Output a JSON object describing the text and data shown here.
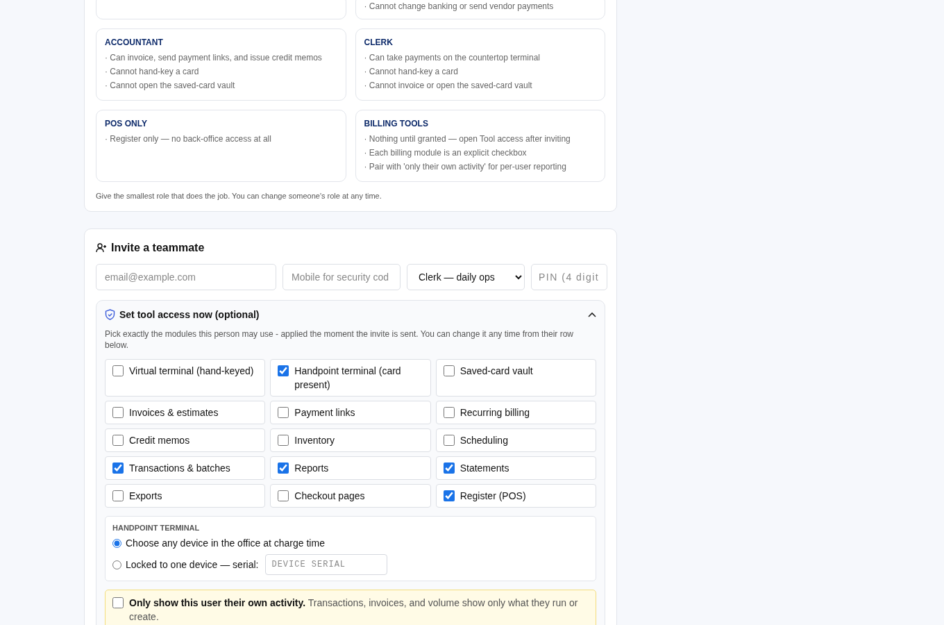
{
  "roles": [
    {
      "lines": [
        "· Cannot change banking or send vendor payments"
      ]
    },
    {
      "title": "ACCOUNTANT",
      "lines": [
        "· Can invoice, send payment links, and issue credit memos",
        "· Cannot hand-key a card",
        "· Cannot open the saved-card vault"
      ]
    },
    {
      "title": "CLERK",
      "lines": [
        "· Can take payments on the countertop terminal",
        "· Cannot hand-key a card",
        "· Cannot invoice or open the saved-card vault"
      ]
    },
    {
      "title": "POS ONLY",
      "lines": [
        "· Register only — no back-office access at all"
      ]
    },
    {
      "title": "BILLING TOOLS",
      "lines": [
        "· Nothing until granted — open Tool access after inviting",
        "· Each billing module is an explicit checkbox",
        "· Pair with 'only their own activity' for per-user reporting"
      ]
    }
  ],
  "roles_note": "Give the smallest role that does the job. You can change someone's role at any time.",
  "invite": {
    "title": "Invite a teammate",
    "email": {
      "placeholder": "email@example.com"
    },
    "mobile": {
      "placeholder": "Mobile for security cod"
    },
    "role": {
      "value": "Clerk — daily ops"
    },
    "pin": {
      "placeholder": "PIN (4 digit"
    },
    "tool_access": {
      "title": "Set tool access now (optional)",
      "expanded": true,
      "description": "Pick exactly the modules this person may use - applied the moment the invite is sent. You can change it any time from their row below.",
      "modules": [
        {
          "label": "Virtual terminal (hand-keyed)",
          "checked": false
        },
        {
          "label": "Handpoint terminal (card present)",
          "checked": true
        },
        {
          "label": "Saved-card vault",
          "checked": false
        },
        {
          "label": "Invoices & estimates",
          "checked": false
        },
        {
          "label": "Payment links",
          "checked": false
        },
        {
          "label": "Recurring billing",
          "checked": false
        },
        {
          "label": "Credit memos",
          "checked": false
        },
        {
          "label": "Inventory",
          "checked": false
        },
        {
          "label": "Scheduling",
          "checked": false
        },
        {
          "label": "Transactions & batches",
          "checked": true
        },
        {
          "label": "Reports",
          "checked": true
        },
        {
          "label": "Statements",
          "checked": true
        },
        {
          "label": "Exports",
          "checked": false
        },
        {
          "label": "Checkout pages",
          "checked": false
        },
        {
          "label": "Register (POS)",
          "checked": true
        }
      ],
      "terminal": {
        "heading": "HANDPOINT TERMINAL",
        "options": [
          {
            "label": "Choose any device in the office at charge time",
            "selected": true
          },
          {
            "label": "Locked to one device — serial:",
            "selected": false,
            "field_placeholder": "DEVICE SERIAL"
          }
        ]
      },
      "own_activity": {
        "checked": false,
        "text": "**Only show this user their own activity.** Transactions, invoices, and volume show only what they run or create."
      }
    }
  }
}
